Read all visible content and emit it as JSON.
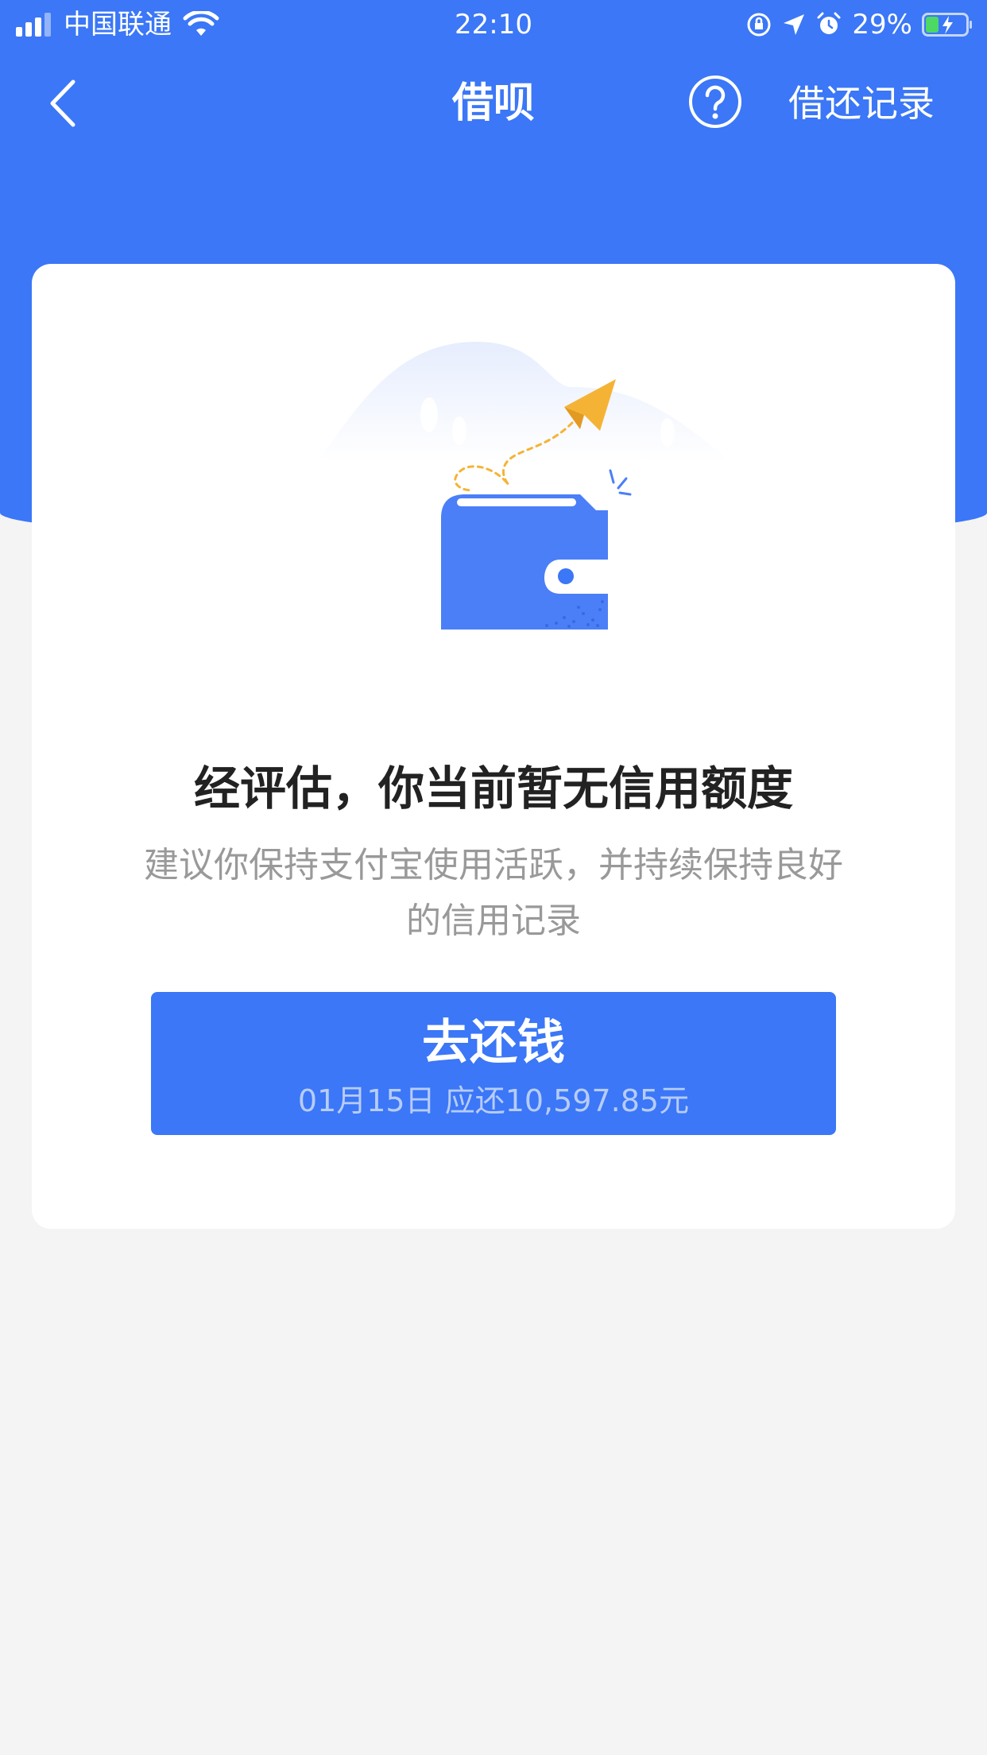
{
  "status_bar": {
    "carrier": "中国联通",
    "time": "22:10",
    "battery_percent": "29%",
    "icons": [
      "signal-icon",
      "wifi-icon",
      "rotation-lock-icon",
      "location-icon",
      "alarm-icon",
      "battery-charging-icon"
    ]
  },
  "nav": {
    "title": "借呗",
    "records_label": "借还记录",
    "back_icon": "chevron-left-icon",
    "help_icon": "question-circle-icon"
  },
  "card": {
    "illustration": "wallet-paper-plane-illustration",
    "headline": "经评估，你当前暂无信用额度",
    "subtext": "建议你保持支付宝使用活跃，并持续保持良好的信用记录",
    "button_label": "去还钱",
    "button_sub": "01月15日 应还10,597.85元"
  },
  "colors": {
    "brand_blue": "#3b77f6",
    "plane_yellow": "#f5b335",
    "background": "#f4f4f4"
  }
}
